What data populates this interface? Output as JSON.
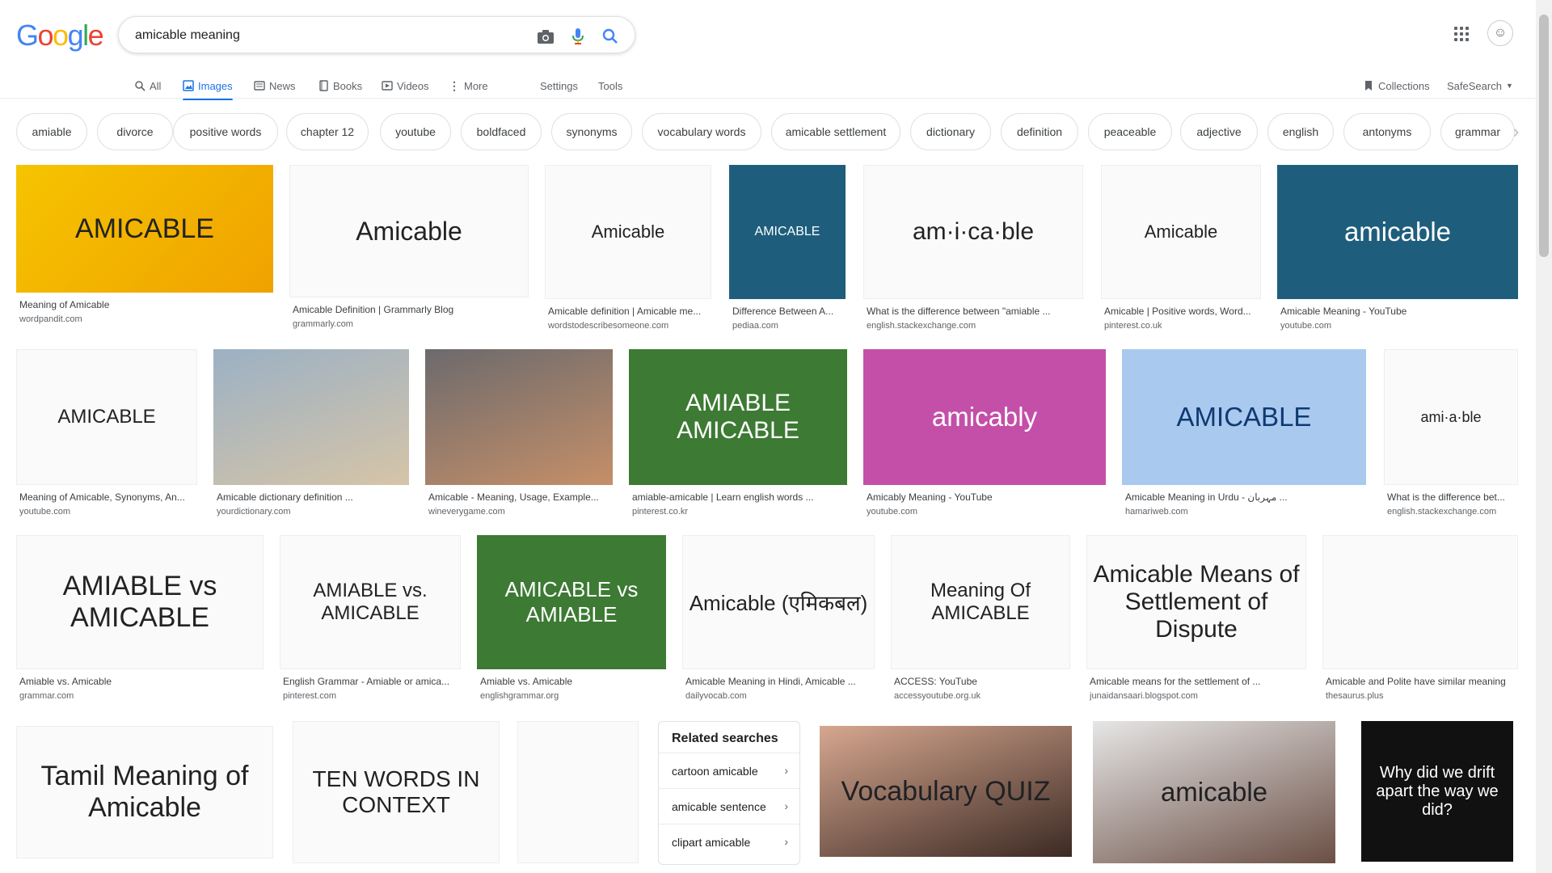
{
  "search": {
    "query": "amicable meaning"
  },
  "logo": "Google",
  "nav": {
    "tabs": [
      {
        "label": "All",
        "icon": "search-icon"
      },
      {
        "label": "Images",
        "icon": "image-icon",
        "active": true
      },
      {
        "label": "News",
        "icon": "news-icon"
      },
      {
        "label": "Books",
        "icon": "book-icon"
      },
      {
        "label": "Videos",
        "icon": "video-icon"
      },
      {
        "label": "More",
        "icon": "more-vert-icon"
      }
    ],
    "settings": "Settings",
    "tools": "Tools",
    "collections": "Collections",
    "safesearch": "SafeSearch"
  },
  "chips": [
    "amiable",
    "divorce",
    "positive words",
    "chapter 12",
    "youtube",
    "boldfaced",
    "synonyms",
    "vocabulary words",
    "amicable settlement",
    "dictionary",
    "definition",
    "peaceable",
    "adjective",
    "english",
    "antonyms",
    "grammar"
  ],
  "results": [
    {
      "title": "Meaning of Amicable",
      "source": "wordpandit.com",
      "thumb_text": "AMICABLE",
      "style": "t-yellow"
    },
    {
      "title": "Amicable Definition | Grammarly Blog",
      "source": "grammarly.com",
      "thumb_text": "Amicable",
      "style": "t-white"
    },
    {
      "title": "Amicable definition | Amicable me...",
      "source": "wordstodescribesomeone.com",
      "thumb_text": "Amicable",
      "style": "t-white"
    },
    {
      "title": "Difference Between A...",
      "source": "pediaa.com",
      "thumb_text": "AMICABLE",
      "style": "t-navy"
    },
    {
      "title": "What is the difference between \"amiable ...",
      "source": "english.stackexchange.com",
      "thumb_text": "am·i·ca·ble",
      "style": "t-white"
    },
    {
      "title": "Amicable | Positive words, Word...",
      "source": "pinterest.co.uk",
      "thumb_text": "Amicable",
      "style": "t-white"
    },
    {
      "title": "Amicable Meaning - YouTube",
      "source": "youtube.com",
      "thumb_text": "amicable",
      "style": "t-navy"
    },
    {
      "title": "Meaning of Amicable, Synonyms, An...",
      "source": "youtube.com",
      "thumb_text": "AMICABLE",
      "style": "t-white"
    },
    {
      "title": "Amicable dictionary definition ...",
      "source": "yourdictionary.com",
      "thumb_text": "",
      "style": "t-photo1"
    },
    {
      "title": "Amicable - Meaning, Usage, Example...",
      "source": "wineverygame.com",
      "thumb_text": "",
      "style": "t-photo2"
    },
    {
      "title": "amiable-amicable | Learn english words ...",
      "source": "pinterest.co.kr",
      "thumb_text": "AMIABLE   AMICABLE",
      "style": "t-green"
    },
    {
      "title": "Amicably Meaning - YouTube",
      "source": "youtube.com",
      "thumb_text": "amicably",
      "style": "t-pink"
    },
    {
      "title": "Amicable Meaning in Urdu - مہربان ...",
      "source": "hamariweb.com",
      "thumb_text": "AMICABLE",
      "style": "t-blue"
    },
    {
      "title": "What is the difference bet...",
      "source": "english.stackexchange.com",
      "thumb_text": "ami·a·ble",
      "style": "t-white"
    },
    {
      "title": "Amiable vs. Amicable",
      "source": "grammar.com",
      "thumb_text": "AMIABLE vs AMICABLE",
      "style": "t-white"
    },
    {
      "title": "English Grammar - Amiable or amica...",
      "source": "pinterest.com",
      "thumb_text": "AMIABLE vs. AMICABLE",
      "style": "t-white"
    },
    {
      "title": "Amiable vs. Amicable",
      "source": "englishgrammar.org",
      "thumb_text": "AMICABLE vs AMIABLE",
      "style": "t-green"
    },
    {
      "title": "Amicable Meaning in Hindi, Amicable ...",
      "source": "dailyvocab.com",
      "thumb_text": "Amicable (एमिकबल)",
      "style": "t-white"
    },
    {
      "title": "ACCESS: YouTube",
      "source": "accessyoutube.org.uk",
      "thumb_text": "Meaning Of AMICABLE",
      "style": "t-white"
    },
    {
      "title": "Amicable means for the settlement of ...",
      "source": "junaidansaari.blogspot.com",
      "thumb_text": "Amicable Means of Settlement of Dispute",
      "style": "t-white"
    },
    {
      "title": "Amicable and Polite have similar meaning",
      "source": "thesaurus.plus",
      "thumb_text": "",
      "style": "t-white"
    },
    {
      "title": "",
      "source": "",
      "thumb_text": "Tamil Meaning of Amicable",
      "style": "t-white"
    },
    {
      "title": "",
      "source": "",
      "thumb_text": "TEN WORDS IN CONTEXT",
      "style": "t-white"
    },
    {
      "title": "",
      "source": "",
      "thumb_text": "",
      "style": "t-white"
    },
    {
      "title": "",
      "source": "",
      "thumb_text": "Vocabulary QUIZ",
      "style": "t-photo3"
    },
    {
      "title": "",
      "source": "",
      "thumb_text": "amicable",
      "style": "t-photo4"
    },
    {
      "title": "",
      "source": "",
      "thumb_text": "Why did we drift apart the way we did?",
      "style": "t-black"
    }
  ],
  "related": {
    "heading": "Related searches",
    "items": [
      "cartoon amicable",
      "amicable sentence",
      "clipart amicable"
    ]
  }
}
